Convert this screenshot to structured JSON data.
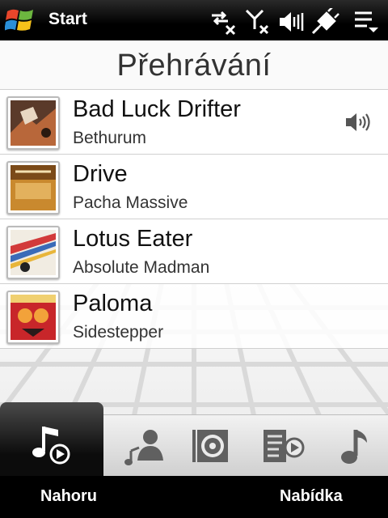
{
  "status_bar": {
    "start_label": "Start",
    "icons": [
      "data-connection-off-icon",
      "signal-off-icon",
      "volume-muted-icon",
      "power-plug-icon",
      "menu-dropdown-icon"
    ]
  },
  "page": {
    "title": "Přehrávání"
  },
  "tracks": [
    {
      "title": "Bad Luck Drifter",
      "artist": "Bethurum",
      "playing": true,
      "album_art": "album-art-bethurum"
    },
    {
      "title": "Drive",
      "artist": "Pacha Massive",
      "playing": false,
      "album_art": "album-art-pacha-massive"
    },
    {
      "title": "Lotus Eater",
      "artist": "Absolute Madman",
      "playing": false,
      "album_art": "album-art-absolute-madman"
    },
    {
      "title": "Paloma",
      "artist": "Sidestepper",
      "playing": false,
      "album_art": "album-art-sidestepper"
    }
  ],
  "tabs": [
    {
      "icon": "now-playing-music-icon",
      "active": true
    },
    {
      "icon": "artists-icon",
      "active": false
    },
    {
      "icon": "albums-icon",
      "active": false
    },
    {
      "icon": "playlists-icon",
      "active": false
    },
    {
      "icon": "songs-music-note-icon",
      "active": false
    }
  ],
  "softkeys": {
    "left": "Nahoru",
    "right": "Nabídka"
  },
  "colors": {
    "accent": "#000000",
    "background": "#fafafa",
    "text": "#111111"
  }
}
